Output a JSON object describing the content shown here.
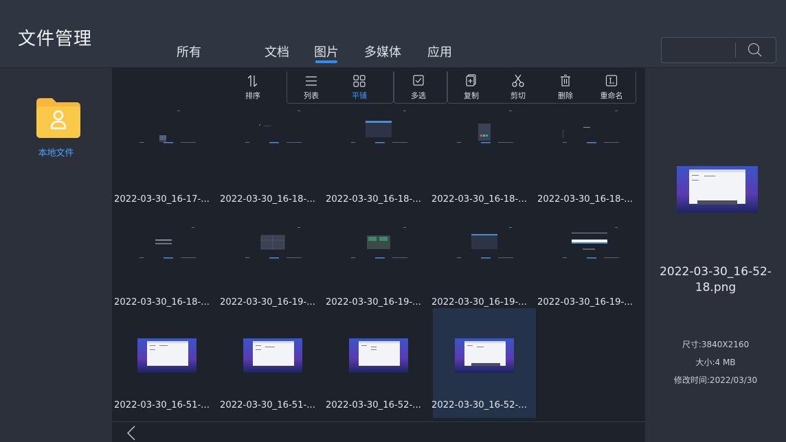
{
  "app": {
    "title": "文件管理"
  },
  "tabs": [
    {
      "label": "所有"
    },
    {
      "label": "文档"
    },
    {
      "label": "图片"
    },
    {
      "label": "多媒体"
    },
    {
      "label": "应用"
    }
  ],
  "active_tab": "图片",
  "search": {
    "placeholder": "",
    "value": ""
  },
  "sidebar": {
    "items": [
      {
        "label": "本地文件",
        "icon": "folder-user-icon"
      }
    ]
  },
  "toolbar": {
    "sort": "排序",
    "list": "列表",
    "grid": "平铺",
    "multi_select": "多选",
    "copy": "复制",
    "cut": "剪切",
    "delete": "删除",
    "rename": "重命名"
  },
  "files": [
    {
      "name": "2022-03-30_16-17-..."
    },
    {
      "name": "2022-03-30_16-18-..."
    },
    {
      "name": "2022-03-30_16-18-..."
    },
    {
      "name": "2022-03-30_16-18-..."
    },
    {
      "name": "2022-03-30_16-18-..."
    },
    {
      "name": "2022-03-30_16-18-..."
    },
    {
      "name": "2022-03-30_16-19-..."
    },
    {
      "name": "2022-03-30_16-19-..."
    },
    {
      "name": "2022-03-30_16-19-..."
    },
    {
      "name": "2022-03-30_16-19-..."
    },
    {
      "name": "2022-03-30_16-51-..."
    },
    {
      "name": "2022-03-30_16-51-..."
    },
    {
      "name": "2022-03-30_16-52-..."
    },
    {
      "name": "2022-03-30_16-52-..."
    }
  ],
  "selected_index": 13,
  "preview": {
    "name_line1": "2022-03-30_16-52-",
    "name_line2": "18.png",
    "size": "尺寸:3840X2160",
    "filesize": "大小:4 MB",
    "modified": "修改时间:2022/03/30"
  },
  "colors": {
    "accent": "#2f8ff2",
    "folder": "#f6b73c",
    "selected_bg": "#243349"
  }
}
